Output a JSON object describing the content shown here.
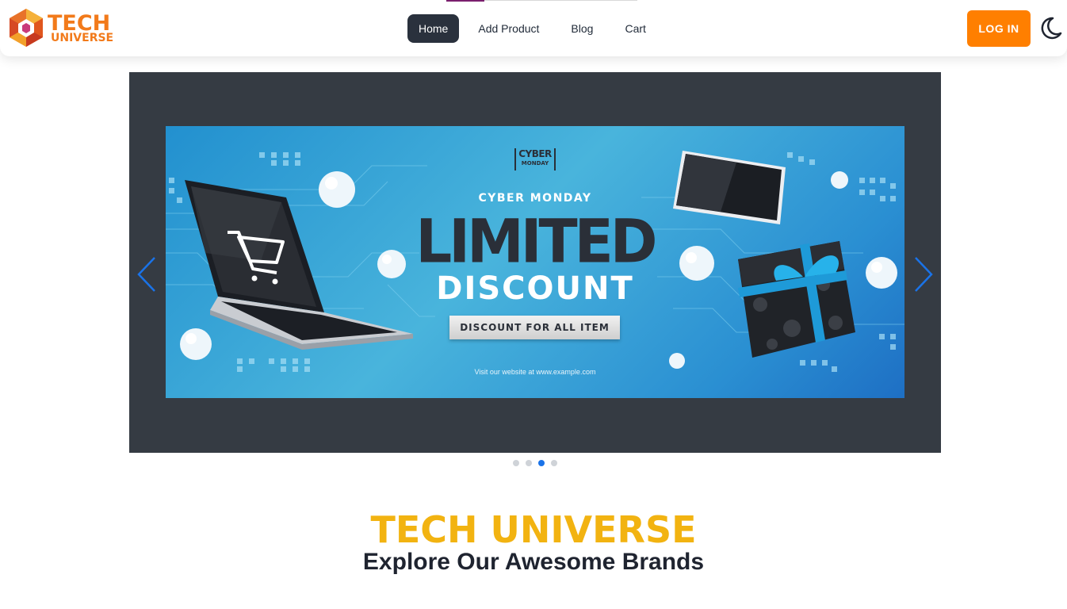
{
  "logo": {
    "line1": "TECH",
    "line2": "UNIVERSE"
  },
  "nav": {
    "items": [
      {
        "label": "Home",
        "active": true
      },
      {
        "label": "Add Product",
        "active": false
      },
      {
        "label": "Blog",
        "active": false
      },
      {
        "label": "Cart",
        "active": false
      }
    ],
    "login_label": "LOG IN",
    "theme_icon": "moon-icon"
  },
  "carousel": {
    "slide_count": 4,
    "active_slide": 3,
    "prev_icon": "chevron-left-icon",
    "next_icon": "chevron-right-icon",
    "banner": {
      "badge_top": "CYBER",
      "badge_bottom": "MONDAY",
      "eyebrow": "CYBER MONDAY",
      "headline": "LIMITED",
      "subheadline": "DISCOUNT",
      "pill": "DISCOUNT FOR ALL ITEM",
      "footnote": "Visit our website at www.example.com"
    }
  },
  "hero": {
    "title": "TECH UNIVERSE",
    "subtitle": "Explore Our Awesome Brands"
  },
  "colors": {
    "accent": "#ff7f00",
    "title_yellow": "#f2b311",
    "nav_active": "#2a313d",
    "carousel_bg": "#353b43",
    "dot_active": "#1a73e8"
  }
}
